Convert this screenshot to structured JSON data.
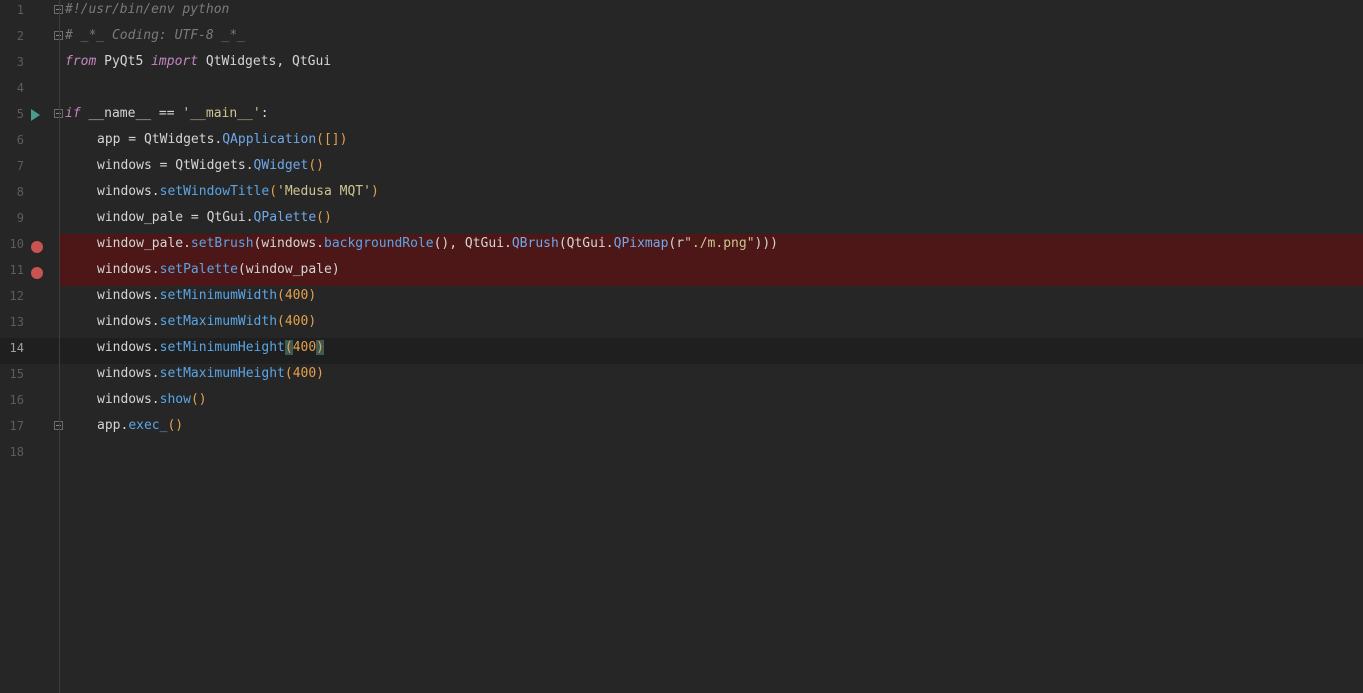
{
  "editor": {
    "language": "python",
    "current_line": 14,
    "colors": {
      "background": "#262626",
      "breakpoint_line": "#4d1717",
      "breakpoint_dot": "#c75450",
      "run_icon": "#499c8a",
      "keyword": "#c586c0",
      "method": "#5aa5e6",
      "string": "#cfc58f",
      "number": "#e5a04c",
      "comment": "#7a7a7a"
    },
    "lines": [
      {
        "num": "1",
        "t": [
          "#!/usr/bin/env python"
        ]
      },
      {
        "num": "2",
        "t": [
          "# _*_ Coding: UTF-8 _*_"
        ]
      },
      {
        "num": "3",
        "t": [
          "from",
          " PyQt5 ",
          "import",
          " QtWidgets, QtGui"
        ]
      },
      {
        "num": "4",
        "t": []
      },
      {
        "num": "5",
        "t": [
          "if",
          " __name__ == ",
          "'__main__'",
          ":"
        ]
      },
      {
        "num": "6",
        "t": [
          "app = QtWidgets.",
          "QApplication",
          "([])"
        ]
      },
      {
        "num": "7",
        "t": [
          "windows = QtWidgets.",
          "QWidget",
          "()"
        ]
      },
      {
        "num": "8",
        "t": [
          "windows.",
          "setWindowTitle",
          "(",
          "'Medusa MQT'",
          ")"
        ]
      },
      {
        "num": "9",
        "t": [
          "window_pale = QtGui.",
          "QPalette",
          "()"
        ]
      },
      {
        "num": "10",
        "t": [
          "window_pale.",
          "setBrush",
          "(windows.",
          "backgroundRole",
          "(), QtGui.",
          "QBrush",
          "(QtGui.",
          "QPixmap",
          "(r",
          "\"./m.png\"",
          ")))"
        ]
      },
      {
        "num": "11",
        "t": [
          "windows.",
          "setPalette",
          "(window_pale)"
        ]
      },
      {
        "num": "12",
        "t": [
          "windows.",
          "setMinimumWidth",
          "(",
          "400",
          ")"
        ]
      },
      {
        "num": "13",
        "t": [
          "windows.",
          "setMaximumWidth",
          "(",
          "400",
          ")"
        ]
      },
      {
        "num": "14",
        "t": [
          "windows.",
          "setMinimumHeight",
          "(",
          "400",
          ")"
        ]
      },
      {
        "num": "15",
        "t": [
          "windows.",
          "setMaximumHeight",
          "(",
          "400",
          ")"
        ]
      },
      {
        "num": "16",
        "t": [
          "windows.",
          "show",
          "()"
        ]
      },
      {
        "num": "17",
        "t": [
          "app.",
          "exec_",
          "()"
        ]
      },
      {
        "num": "18",
        "t": []
      }
    ]
  }
}
